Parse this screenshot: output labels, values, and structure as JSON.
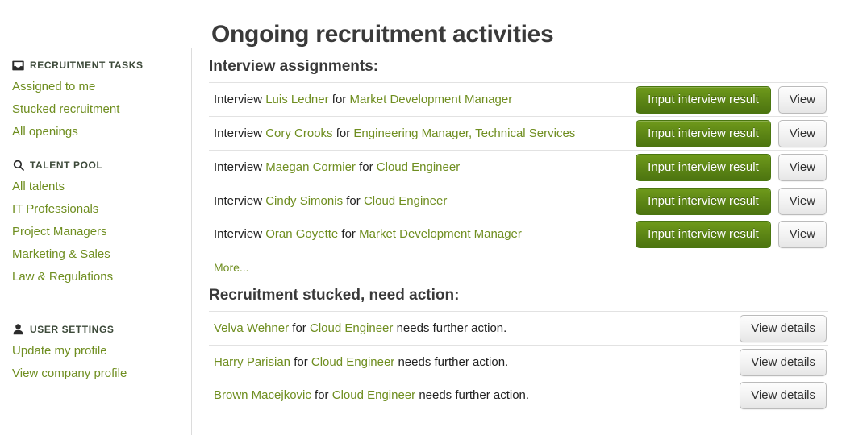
{
  "page": {
    "title": "Ongoing recruitment activities"
  },
  "colors": {
    "link_green": "#6f8e20",
    "button_green_top": "#6f9a1b",
    "button_green_bottom": "#4d7410",
    "heading_dark": "#3a3a3a",
    "divider": "#e2e2e2"
  },
  "sidebar": {
    "groups": [
      {
        "icon": "inbox-icon",
        "heading": "RECRUITMENT TASKS",
        "items": [
          {
            "label": "Assigned to me"
          },
          {
            "label": "Stucked recruitment"
          },
          {
            "label": "All openings"
          }
        ]
      },
      {
        "icon": "search-icon",
        "heading": "TALENT POOL",
        "items": [
          {
            "label": "All talents"
          },
          {
            "label": "IT Professionals"
          },
          {
            "label": "Project Managers"
          },
          {
            "label": "Marketing & Sales"
          },
          {
            "label": "Law & Regulations"
          }
        ]
      },
      {
        "icon": "user-icon",
        "heading": "USER SETTINGS",
        "items": [
          {
            "label": "Update my profile"
          },
          {
            "label": "View company profile"
          }
        ]
      }
    ]
  },
  "main": {
    "interview_section": {
      "title": "Interview assignments:",
      "prefix": "Interview",
      "connector": "for",
      "primary_button": "Input interview result",
      "secondary_button": "View",
      "more_label": "More...",
      "rows": [
        {
          "candidate": "Luis Ledner",
          "position": "Market Development Manager"
        },
        {
          "candidate": "Cory Crooks",
          "position": "Engineering Manager, Technical Services"
        },
        {
          "candidate": "Maegan Cormier",
          "position": "Cloud Engineer"
        },
        {
          "candidate": "Cindy Simonis",
          "position": "Cloud Engineer"
        },
        {
          "candidate": "Oran Goyette",
          "position": "Market Development Manager"
        }
      ]
    },
    "stucked_section": {
      "title": "Recruitment stucked, need action:",
      "connector": "for",
      "suffix": "needs further action.",
      "button": "View details",
      "rows": [
        {
          "candidate": "Velva Wehner",
          "position": "Cloud Engineer"
        },
        {
          "candidate": "Harry Parisian",
          "position": "Cloud Engineer"
        },
        {
          "candidate": "Brown Macejkovic",
          "position": "Cloud Engineer"
        }
      ]
    }
  }
}
